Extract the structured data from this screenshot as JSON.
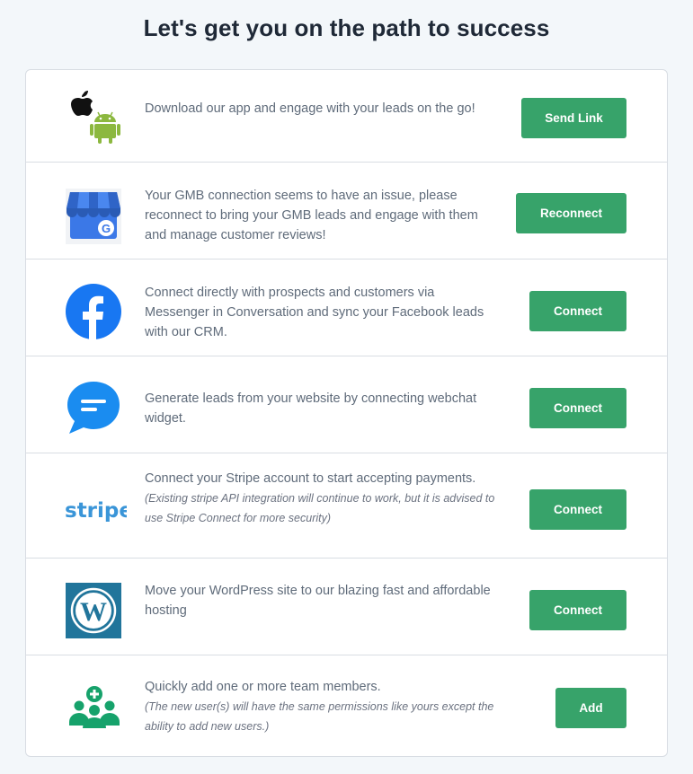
{
  "title": "Let's get you on the path to success",
  "rows": [
    {
      "text": "Download our app and engage with your leads on the go!",
      "button": "Send Link",
      "icon": "apple-android-icon"
    },
    {
      "text": "Your GMB connection seems to have an issue, please reconnect to bring your GMB leads and engage with them and manage customer reviews!",
      "button": "Reconnect",
      "icon": "google-my-business-icon"
    },
    {
      "text": "Connect directly with prospects and customers via Messenger in Conversation and sync your Facebook leads with our CRM.",
      "button": "Connect",
      "icon": "facebook-icon"
    },
    {
      "text": "Generate leads from your website by connecting webchat widget.",
      "button": "Connect",
      "icon": "webchat-icon"
    },
    {
      "text": "Connect your Stripe account to start accepting payments.",
      "note": "(Existing stripe API integration will continue to work, but it is advised to use Stripe Connect for more security)",
      "button": "Connect",
      "icon": "stripe-icon",
      "logo_text": "stripe"
    },
    {
      "text": "Move your WordPress site to our blazing fast and affordable hosting",
      "button": "Connect",
      "icon": "wordpress-icon"
    },
    {
      "text": "Quickly add one or more team members.",
      "note": "(The new user(s) will have the same permissions like yours except the ability to add new users.)",
      "button": "Add",
      "icon": "add-team-icon"
    }
  ],
  "colors": {
    "accent": "#37a36a",
    "facebook": "#1877f2",
    "webchat": "#1a8cf0",
    "stripe": "#3a95d8",
    "wordpress": "#21759b",
    "team": "#16a26b"
  }
}
